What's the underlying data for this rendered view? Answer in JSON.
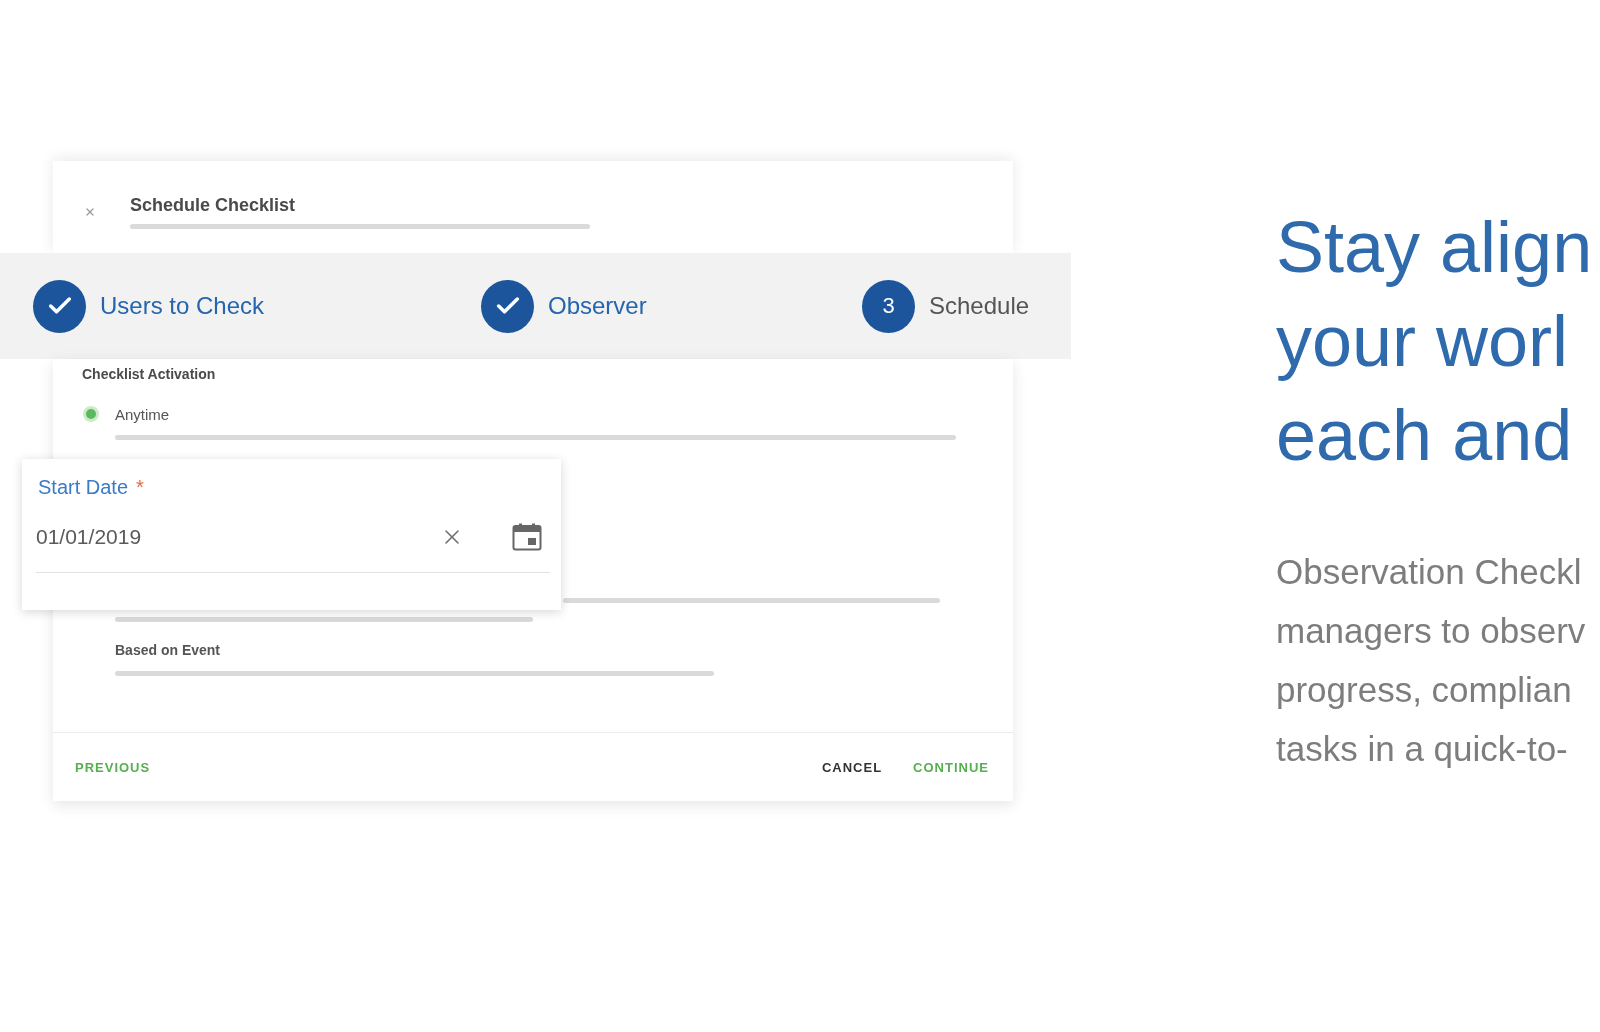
{
  "dialog": {
    "title": "Schedule Checklist"
  },
  "stepper": {
    "steps": [
      {
        "label": "Users to Check",
        "completed": true
      },
      {
        "label": "Observer",
        "completed": true
      },
      {
        "label": "Schedule",
        "number": "3",
        "completed": false
      }
    ]
  },
  "activation": {
    "heading": "Checklist Activation",
    "options": [
      {
        "label": "Anytime",
        "selected": true
      }
    ],
    "event_label": "Based on Event"
  },
  "date_popup": {
    "label": "Start Date",
    "required_mark": "*",
    "value": "01/01/2019"
  },
  "footer": {
    "left_buttons": [
      {
        "label": "PREVIOUS",
        "kind": "primary"
      }
    ],
    "right_buttons": [
      {
        "label": "CANCEL",
        "kind": "secondary"
      },
      {
        "label": "CONTINUE",
        "kind": "primary"
      }
    ]
  },
  "promo": {
    "headline_lines": [
      "Stay align",
      "your worl",
      "each and"
    ],
    "body_lines": [
      "Observation Checkl",
      "managers to observ",
      "progress, complian",
      "tasks in a quick-to-"
    ]
  }
}
